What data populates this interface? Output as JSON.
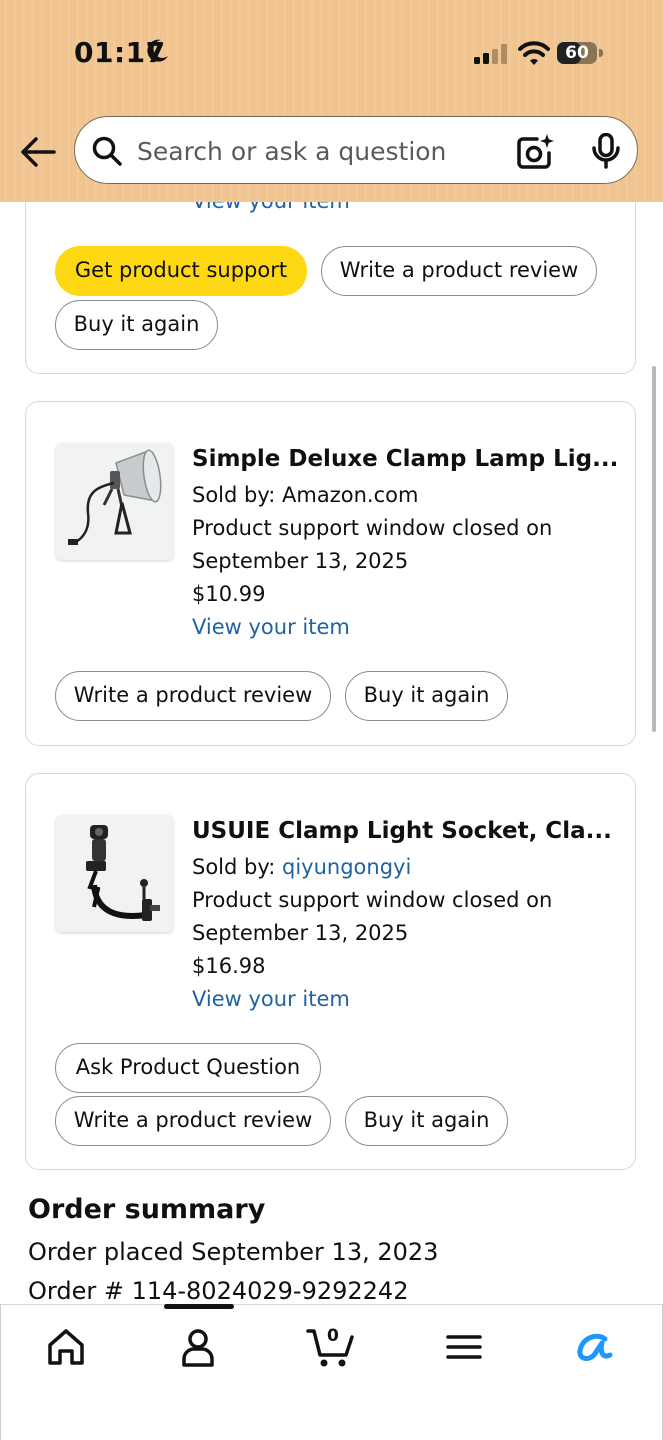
{
  "status_bar": {
    "time": "01:17",
    "battery": "60",
    "battery_level": 0.6,
    "icons": [
      "moon-icon",
      "signal-icon",
      "wifi-icon",
      "battery-icon"
    ]
  },
  "search": {
    "placeholder": "Search or ask a question",
    "icons": [
      "back-arrow-icon",
      "search-icon",
      "camera-icon",
      "mic-icon"
    ]
  },
  "top_card": {
    "link": "View your item",
    "buttons": [
      "Get product support",
      "Write a product review",
      "Buy it again"
    ]
  },
  "items": [
    {
      "title": "Simple Deluxe Clamp Lamp Lig...",
      "sold_by_label": "Sold by:",
      "sold_by": "Amazon.com",
      "support_line1": "Product support window closed on",
      "support_line2": "September 13, 2025",
      "price": "$10.99",
      "link": "View your item",
      "buttons": [
        "Write a product review",
        "Buy it again"
      ]
    },
    {
      "title": "USUIE Clamp Light Socket, Cla...",
      "sold_by_label": "Sold by:",
      "sold_by": "qiyungongyi",
      "support_line1": "Product support window closed on",
      "support_line2": "September 13, 2025",
      "price": "$16.98",
      "link": "View your item",
      "buttons": [
        "Ask Product Question",
        "Write a product review",
        "Buy it again"
      ]
    }
  ],
  "order_summary": {
    "title": "Order summary",
    "placed": "Order placed September 13, 2023",
    "number": "Order # 114-8024029-9292242"
  },
  "bottom_nav": {
    "items": [
      "home-icon",
      "account-icon",
      "cart-icon",
      "menu-icon",
      "rufus-icon"
    ],
    "cart_count": "0"
  },
  "colors": {
    "header": "#f2c795",
    "primary_button": "#ffd814",
    "link": "#2162a1",
    "rufus": "#1a98ff"
  }
}
